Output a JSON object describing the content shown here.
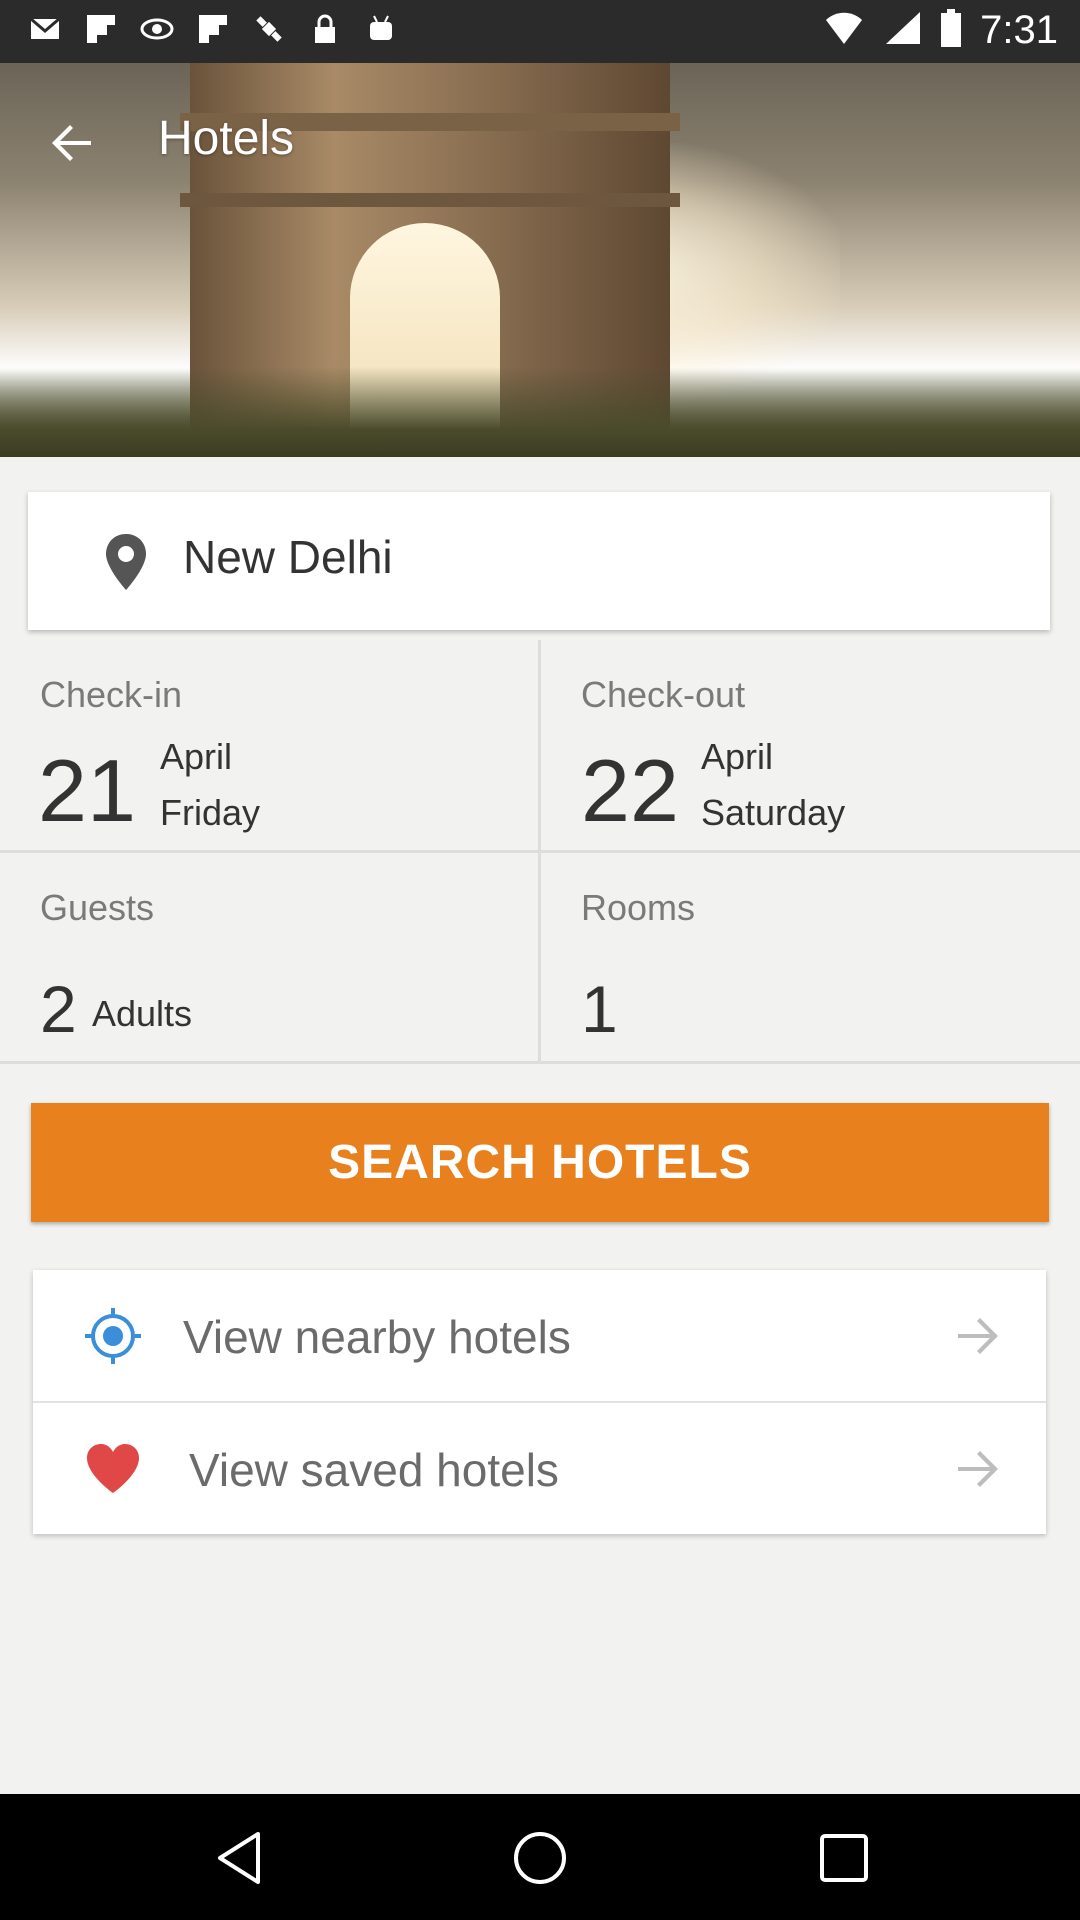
{
  "status_bar": {
    "time": "7:31",
    "icons": [
      "mail-icon",
      "flipboard-icon",
      "eye-icon",
      "flipboard-icon",
      "satellite-icon",
      "lock-icon",
      "android-icon"
    ]
  },
  "toolbar": {
    "title": "Hotels"
  },
  "location": {
    "city": "New Delhi"
  },
  "checkin": {
    "label": "Check-in",
    "day": "21",
    "month": "April",
    "weekday": "Friday"
  },
  "checkout": {
    "label": "Check-out",
    "day": "22",
    "month": "April",
    "weekday": "Saturday"
  },
  "guests": {
    "label": "Guests",
    "count": "2",
    "unit": "Adults"
  },
  "rooms": {
    "label": "Rooms",
    "count": "1"
  },
  "search_button": {
    "label": "SEARCH HOTELS"
  },
  "links": [
    {
      "label": "View nearby hotels",
      "icon": "location-target-icon"
    },
    {
      "label": "View saved hotels",
      "icon": "heart-icon"
    }
  ],
  "colors": {
    "accent": "#e8801e",
    "location_icon": "#3a8fd8",
    "heart_icon": "#e04848"
  }
}
